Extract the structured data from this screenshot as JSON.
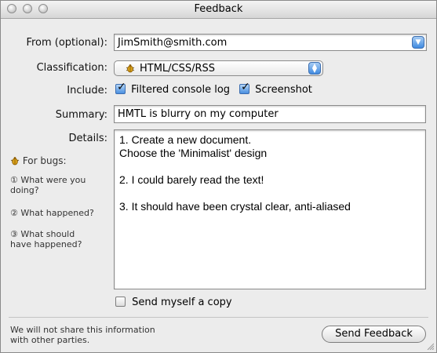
{
  "window": {
    "title": "Feedback"
  },
  "form": {
    "from_label": "From (optional):",
    "from_value": "JimSmith@smith.com",
    "classification_label": "Classification:",
    "classification_value": "HTML/CSS/RSS",
    "include_label": "Include:",
    "include_options": [
      {
        "label": "Filtered console log",
        "checked": true
      },
      {
        "label": "Screenshot",
        "checked": true
      }
    ],
    "summary_label": "Summary:",
    "summary_value": "HMTL is blurry on my computer",
    "details_label": "Details:",
    "details_value": "1. Create a new document.\nChoose the 'Minimalist' design\n\n2. I could barely read the text!\n\n3. It should have been crystal clear, anti-aliased",
    "send_copy_label": "Send myself a copy",
    "send_copy_checked": false
  },
  "help": {
    "for_bugs": "For bugs:",
    "items": [
      {
        "num": "①",
        "text": "What were you doing?"
      },
      {
        "num": "②",
        "text": "What happened?"
      },
      {
        "num": "③",
        "text": "What should have happened?"
      }
    ]
  },
  "footer": {
    "privacy_line1": "We will not share this information",
    "privacy_line2": "with other parties.",
    "send_button": "Send Feedback"
  },
  "icons": {
    "bug": "bug-icon"
  },
  "colors": {
    "accent": "#3f8ae0",
    "window_bg": "#ececec"
  }
}
